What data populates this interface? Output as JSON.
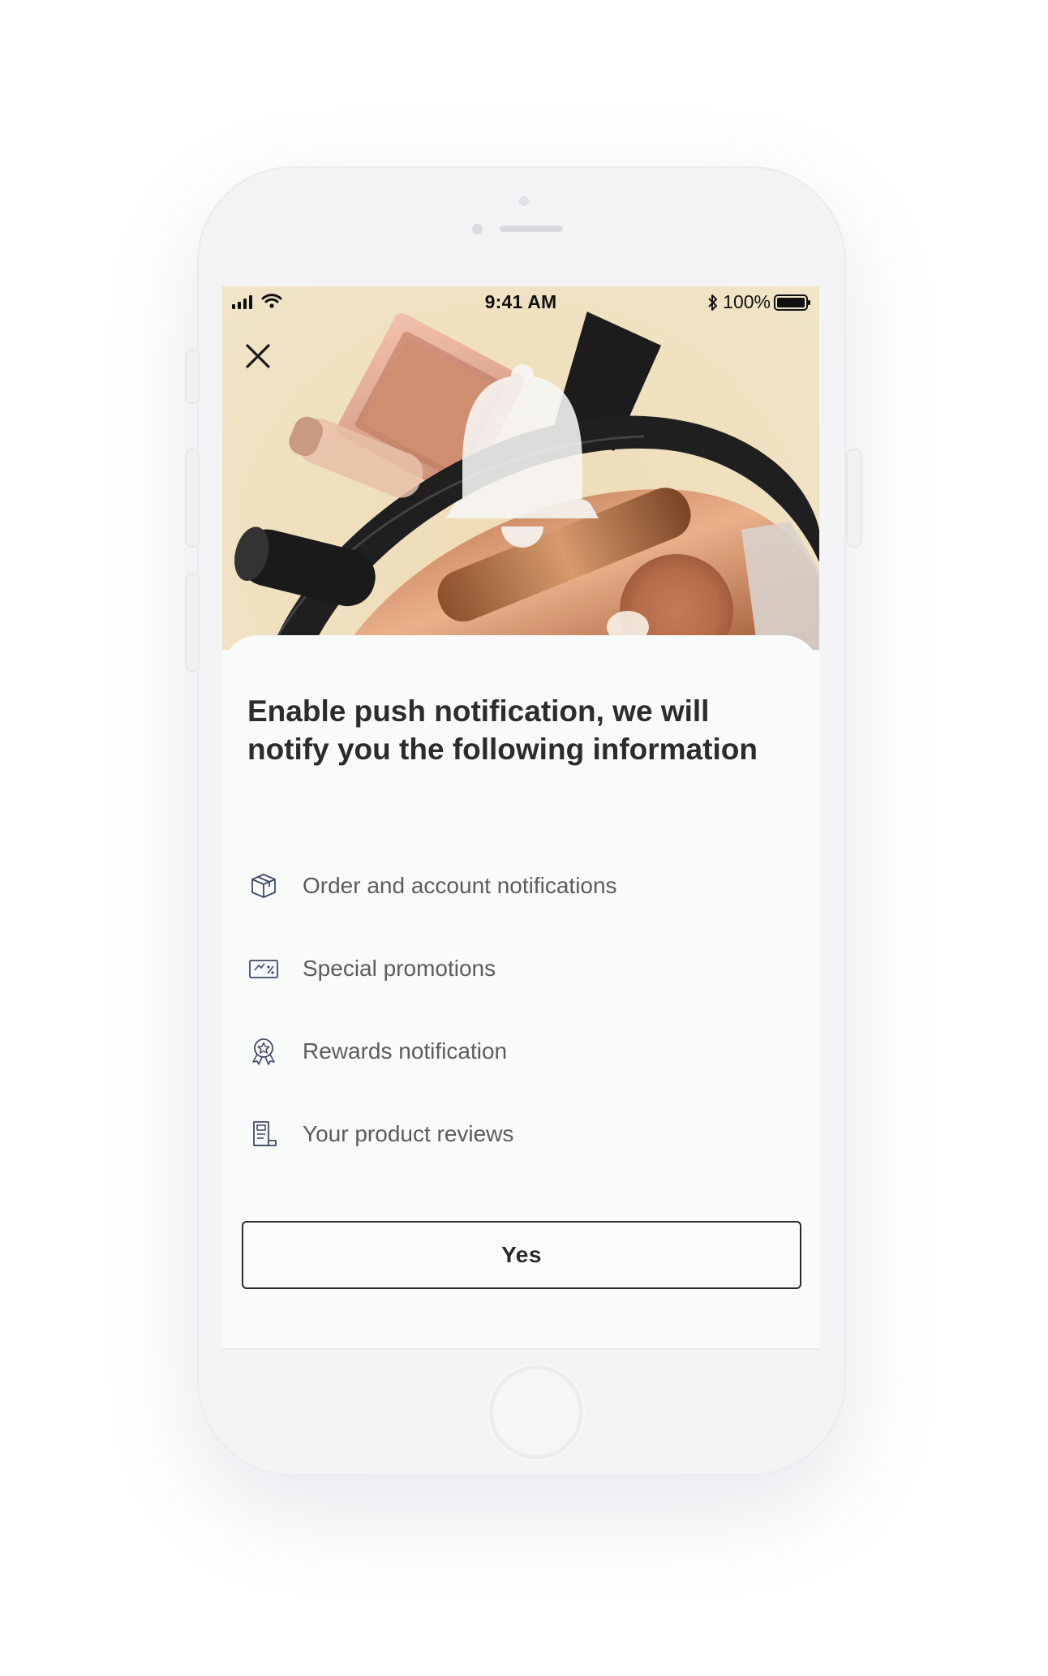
{
  "status_bar": {
    "time": "9:41 AM",
    "battery": "100%"
  },
  "sheet": {
    "title": "Enable push notification, we will notify you the following information",
    "features": [
      {
        "label": "Order and account notifications",
        "icon": "package-icon"
      },
      {
        "label": "Special promotions",
        "icon": "promo-ticket-icon"
      },
      {
        "label": "Rewards notification",
        "icon": "reward-badge-icon"
      },
      {
        "label": "Your product reviews",
        "icon": "review-document-icon"
      }
    ],
    "confirm_label": "Yes"
  },
  "colors": {
    "hero_background": "#efdfbd",
    "sheet_background": "#f9fafa",
    "title_text": "#2c2c2c",
    "body_text": "#5c5c5c",
    "icon_stroke": "#3d4b66",
    "button_border": "#2a2a2a"
  }
}
